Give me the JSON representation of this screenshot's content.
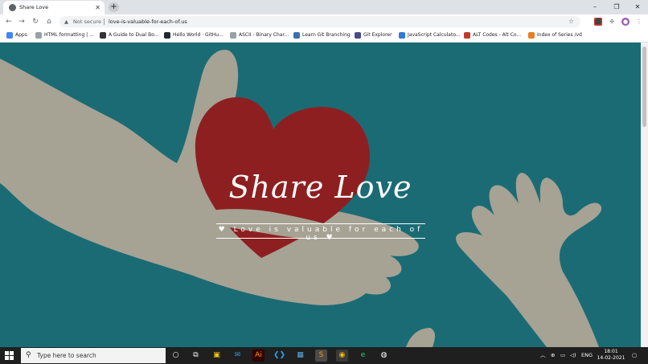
{
  "browser": {
    "tab_title": "Share Love",
    "new_tab": "+",
    "win_min": "–",
    "win_max": "❐",
    "win_close": "✕",
    "security_label": "Not secure",
    "url": "love-is-valuable-for-each-of.us",
    "bookmarks": [
      {
        "label": "Apps",
        "icon": "apps-grid-icon",
        "color": "#4285f4"
      },
      {
        "label": "HTML formatting | ...",
        "icon": "globe-icon",
        "color": "#9aa0a6"
      },
      {
        "label": "A Guide to Dual Bo...",
        "icon": "site-icon",
        "color": "#333333"
      },
      {
        "label": "Hello World · GitHu...",
        "icon": "github-icon",
        "color": "#24292e"
      },
      {
        "label": "ASCII - Binary Char...",
        "icon": "globe-icon",
        "color": "#9aa0a6"
      },
      {
        "label": "Learn Git Branching",
        "icon": "git-icon",
        "color": "#3a6fb0"
      },
      {
        "label": "Git Explorer",
        "icon": "git-explorer-icon",
        "color": "#4a4a8a"
      },
      {
        "label": "JavaScript Calculato...",
        "icon": "js-icon",
        "color": "#2f7bd6"
      },
      {
        "label": "ALT Codes - Alt Co...",
        "icon": "alt-codes-icon",
        "color": "#c0392b"
      },
      {
        "label": "Index of Series /vd",
        "icon": "folder-icon",
        "color": "#e67e22"
      }
    ]
  },
  "hero": {
    "title": "Share Love",
    "subtitle": "♥ Love is valuable for each of us ♥"
  },
  "taskbar": {
    "search_placeholder": "Type here to search",
    "language": "ENG",
    "time": "18:01",
    "date": "14-02-2021"
  },
  "colors": {
    "background": "#1b6b75",
    "heart": "#8e1f20",
    "hand": "#a6a294"
  }
}
